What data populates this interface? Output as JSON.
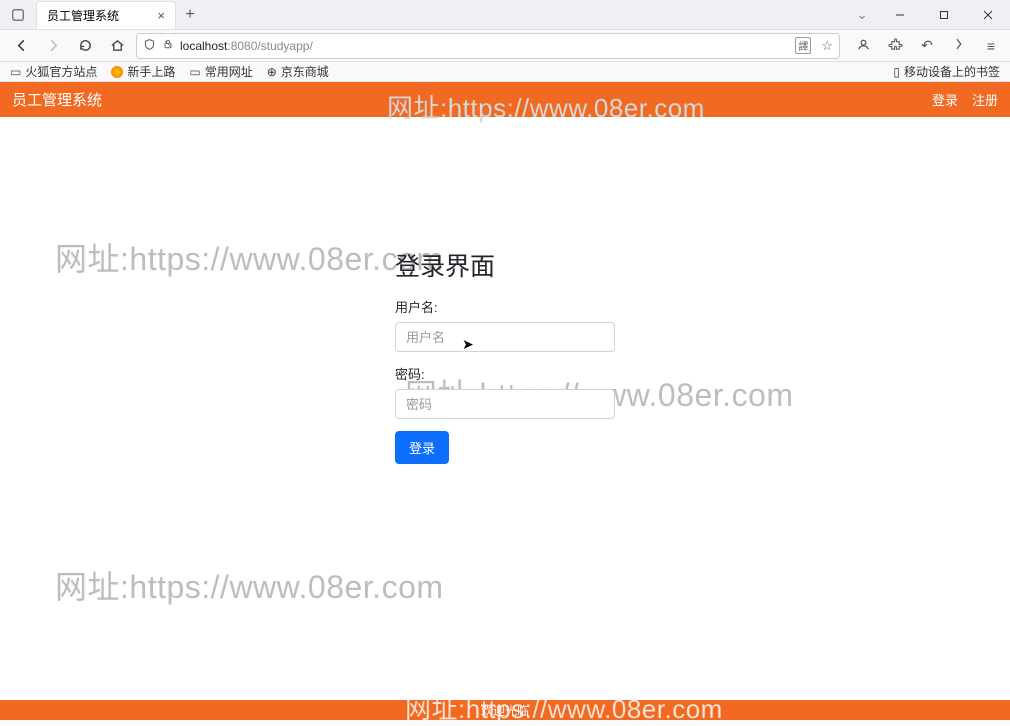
{
  "browser": {
    "tab_title": "员工管理系统",
    "url_host": "localhost",
    "url_port_path": ":8080/studyapp/",
    "reader_badge": "譯",
    "bookmarks": {
      "b1": "火狐官方站点",
      "b2": "新手上路",
      "b3": "常用网址",
      "b4": "京东商城",
      "mobile": "移动设备上的书签"
    }
  },
  "watermark": "网址:https://www.08er.com",
  "header": {
    "title": "员工管理系统",
    "login": "登录",
    "register": "注册"
  },
  "login_form": {
    "heading": "登录界面",
    "username_label": "用户名:",
    "username_placeholder": "用户名",
    "password_label": "密码:",
    "password_placeholder": "密码",
    "submit_label": "登录"
  },
  "footer": {
    "text": "欢迎光临"
  }
}
